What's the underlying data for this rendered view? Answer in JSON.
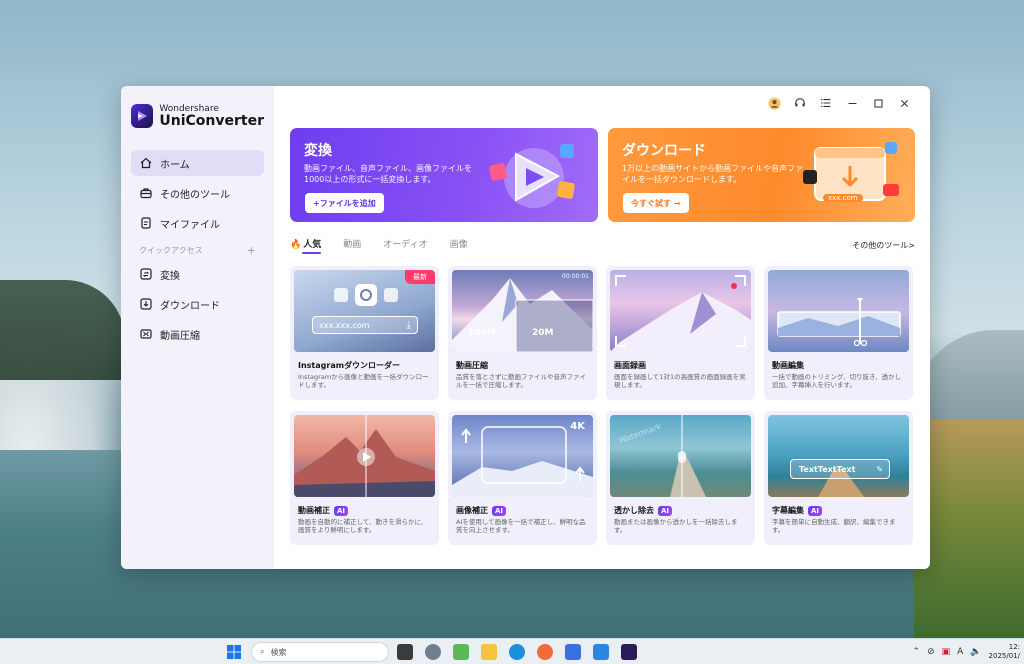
{
  "app": {
    "brand_small": "Wondershare",
    "brand_big": "UniConverter"
  },
  "sidebar": {
    "items": [
      {
        "label": "ホーム",
        "icon": "home-icon",
        "active": true
      },
      {
        "label": "その他のツール",
        "icon": "toolbox-icon"
      },
      {
        "label": "マイファイル",
        "icon": "file-icon"
      }
    ],
    "quick_access_label": "クイックアクセス",
    "quick_add": "+",
    "quick_items": [
      {
        "label": "変換",
        "icon": "convert-icon"
      },
      {
        "label": "ダウンロード",
        "icon": "download-icon"
      },
      {
        "label": "動画圧縮",
        "icon": "compress-icon"
      }
    ]
  },
  "banners": {
    "convert": {
      "title": "変換",
      "desc": "動画ファイル、音声ファイル、画像ファイルを1000以上の形式に一括変換します。",
      "button": "+ファイルを追加"
    },
    "download": {
      "title": "ダウンロード",
      "desc": "1万以上の動画サイトから動画ファイルや音声ファイルを一括ダウンロードします。",
      "button": "今すぐ試す →",
      "art_text": "xxx.com"
    }
  },
  "tabs": {
    "items": [
      "人気",
      "動画",
      "オーディオ",
      "画像"
    ],
    "more": "その他のツール>"
  },
  "cards": [
    {
      "title": "Instagramダウンローダー",
      "desc": "Instagramから画像と動画を一括ダウンロードします。",
      "ai": false,
      "badge": "最新",
      "url_text": "xxx.xxx.com"
    },
    {
      "title": "動画圧縮",
      "desc": "品質を落とさずに動画ファイルや音声ファイルを一括で圧縮します。",
      "ai": false,
      "size_a": "200M",
      "size_b": "20M",
      "time": "00:00:01"
    },
    {
      "title": "画面録画",
      "desc": "画面を録画して1対1の高画質の画面録画を実現します。",
      "ai": false
    },
    {
      "title": "動画編集",
      "desc": "一括で動画のトリミング、切り抜き、透かし追加、字幕挿入を行います。",
      "ai": false
    },
    {
      "title": "動画補正",
      "desc": "動画を自動的に補正して、動きを滑らかに、画質をより鮮明にします。",
      "ai": true,
      "ai_label": "AI"
    },
    {
      "title": "画像補正",
      "desc": "AIを使用して画像を一括で補正し、鮮明な品質を向上させます。",
      "ai": true,
      "ai_label": "AI",
      "tag": "4K"
    },
    {
      "title": "透かし除去",
      "desc": "動画または画像から透かしを一括除去します。",
      "ai": true,
      "ai_label": "AI",
      "wm_text": "Watermark"
    },
    {
      "title": "字幕編集",
      "desc": "字幕を簡単に自動生成、翻訳、編集できます。",
      "ai": true,
      "ai_label": "AI",
      "sample": "TextTextText"
    }
  ],
  "taskbar": {
    "search_placeholder": "検索",
    "tray_lang": "A",
    "time": "12:",
    "date": "2025/01/"
  }
}
